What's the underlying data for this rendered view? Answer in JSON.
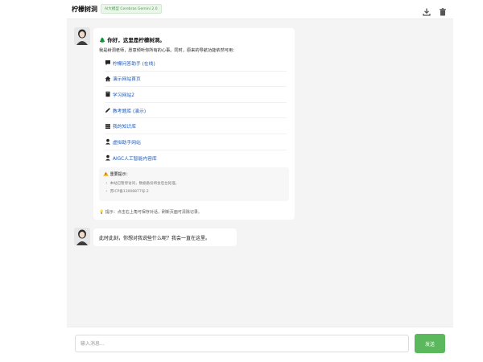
{
  "header": {
    "title": "柠檬树洞",
    "model_badge": "AI大模型 Cerebras Gemini 2.0",
    "download_icon": "download-icon",
    "delete_icon": "trash-icon"
  },
  "welcome": {
    "tree_icon": "🌲",
    "greeting": "你好，这里是柠檬树洞。",
    "intro": "我是树洞老师，愿意倾听你所有的心事。同时，原来的导航功能依然可用：",
    "links": [
      {
        "icon": "chat-icon",
        "label": "柠檬问答助手 (在线)"
      },
      {
        "icon": "home-icon",
        "label": "演示网站首页"
      },
      {
        "icon": "book-icon",
        "label": "学习网站2"
      },
      {
        "icon": "pencil-icon",
        "label": "教考题库 (演示)"
      },
      {
        "icon": "books-icon",
        "label": "我的知识库"
      },
      {
        "icon": "user-icon",
        "label": "虚拟助手网站"
      },
      {
        "icon": "user-icon",
        "label": "AIGC人工智能内容库"
      }
    ],
    "notice": {
      "icon": "warning-icon",
      "title": "重要提示：",
      "items": [
        "本站已暂停访问，数据备份将会后台处理。",
        "苏ICP备13008877号-2"
      ]
    },
    "tip_icon": "💡",
    "tip": "提示：点击右上角可保存对话，刷新页面可清除记录。"
  },
  "reply": {
    "text": "此时此刻，你想对我说些什么呢？我会一直在这里。"
  },
  "composer": {
    "placeholder": "输入消息...",
    "send_label": "发送"
  },
  "colors": {
    "accent": "#5cb85c",
    "link": "#1a57b5",
    "background": "#f4f4f4"
  }
}
